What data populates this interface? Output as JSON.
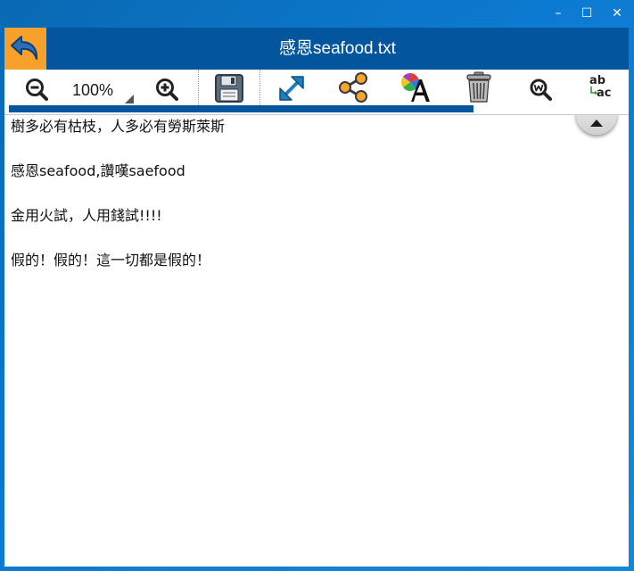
{
  "window": {
    "minimize_icon": "minimize-icon",
    "maximize_icon": "maximize-icon",
    "close_icon": "close-icon",
    "minimize_glyph": "–",
    "maximize_glyph": "☐",
    "close_glyph": "✕"
  },
  "header": {
    "title": "感恩seafood.txt",
    "back_icon": "back-arrow-icon",
    "back_color": "#f8a02c",
    "bar_color": "#03559d"
  },
  "toolbar": {
    "zoom_level": "100%",
    "icons": [
      "zoom-out-icon",
      "zoom-in-icon",
      "save-icon",
      "fullscreen-icon",
      "share-icon",
      "font-color-icon",
      "trash-icon",
      "word-search-icon",
      "spellcheck-icon"
    ],
    "spellcheck_top": "ab",
    "spellcheck_bottom": "ac"
  },
  "document": {
    "lines": [
      "樹多必有枯枝，人多必有勞斯萊斯",
      "",
      "感恩seafood,讚嘆saefood",
      "",
      "金用火試，人用錢試!!!!",
      "",
      "假的！假的！這一切都是假的！"
    ]
  },
  "scroll_up_icon": "scroll-up-arrow-icon"
}
